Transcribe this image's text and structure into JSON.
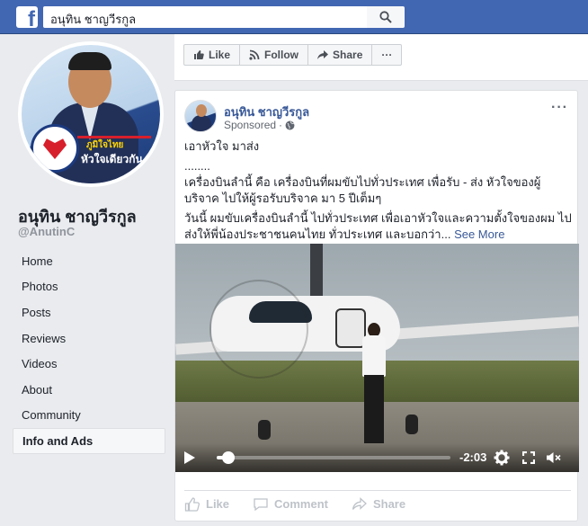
{
  "topbar": {
    "logo": "f",
    "search_value": "อนุทิน ชาญวีรกูล",
    "icons": {
      "logo": "facebook-logo-icon",
      "search": "search-icon"
    }
  },
  "profile": {
    "name": "อนุทิน ชาญวีรกูล",
    "handle": "@AnutinC",
    "slogan_top": "ภูมิใจไทย",
    "slogan_bottom": "หัวใจเดียวกัน"
  },
  "nav": {
    "items": [
      {
        "label": "Home"
      },
      {
        "label": "Photos"
      },
      {
        "label": "Posts"
      },
      {
        "label": "Reviews"
      },
      {
        "label": "Videos"
      },
      {
        "label": "About"
      },
      {
        "label": "Community"
      },
      {
        "label": "Info and Ads",
        "active": true
      }
    ]
  },
  "actions": {
    "like": "Like",
    "follow": "Follow",
    "share": "Share",
    "more": "···"
  },
  "post": {
    "author": "อนุทิน ชาญวีรกูล",
    "sponsored": "Sponsored",
    "menu": "···",
    "line1": "เอาหัวใจ มาส่ง",
    "line2": "........",
    "paragraph1": "เครื่องบินลำนี้ คือ เครื่องบินที่ผมขับไปทั่วประเทศ เพื่อรับ - ส่ง หัวใจของผู้บริจาค ไปให้ผู้รอรับบริจาค มา 5 ปีเต็มๆ",
    "paragraph2": "วันนี้ ผมขับเครื่องบินลำนี้ ไปทั่วประเทศ เพื่อเอาหัวใจและความตั้งใจของผม ไปส่งให้พี่น้องประชาชนคนไทย ทั่วประเทศ และบอกว่า...",
    "see_more": "See More",
    "video": {
      "time_remaining": "-2:03",
      "progress": 0.05
    },
    "footer": {
      "like": "Like",
      "comment": "Comment",
      "share": "Share"
    }
  },
  "colors": {
    "brand_blue": "#4267b2",
    "link_blue": "#385898",
    "page_bg": "#e9ebee"
  }
}
